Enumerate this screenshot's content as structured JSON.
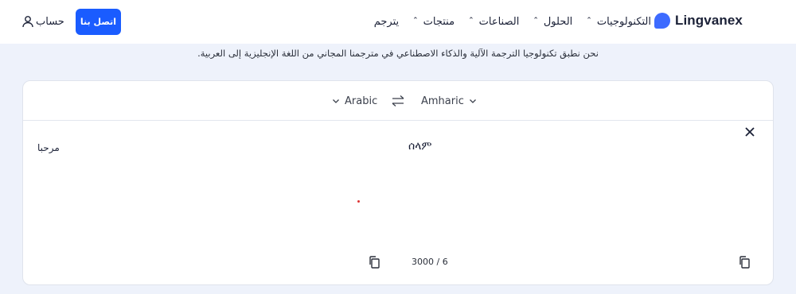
{
  "header": {
    "logo_text": "Lingvanex",
    "nav": [
      {
        "label": "التكنولوجيات",
        "has_caret": true
      },
      {
        "label": "الحلول",
        "has_caret": true
      },
      {
        "label": "الصناعات",
        "has_caret": true
      },
      {
        "label": "منتجات",
        "has_caret": true
      },
      {
        "label": "يترجم",
        "has_caret": false
      }
    ],
    "contact_label": "اتصل بنا",
    "account_label": "حساب"
  },
  "tagline": "نحن نطبق تكنولوجيا الترجمة الآلية والذكاء الاصطناعي في مترجمنا المجاني من اللغة الإنجليزية إلى العربية.",
  "translator": {
    "target_language": "Arabic",
    "source_language": "Amharic",
    "source_text": "ሰላም",
    "target_text": "مرحبا",
    "char_counter": "3000 / 6"
  },
  "colors": {
    "accent": "#1a5cff",
    "logo": "#3d6bff",
    "page_bg": "#eef2fb"
  },
  "icons": [
    "user-icon",
    "swap-icon",
    "close-icon",
    "copy-icon",
    "chevron-down-icon"
  ]
}
